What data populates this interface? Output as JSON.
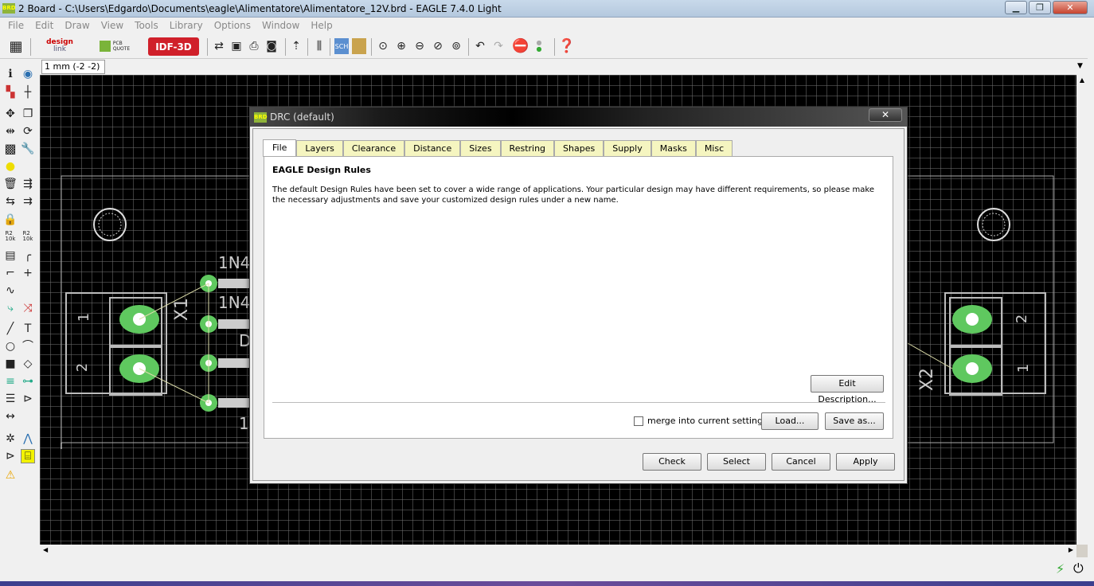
{
  "window": {
    "title": "2 Board - C:\\Users\\Edgardo\\Documents\\eagle\\Alimentatore\\Alimentatore_12V.brd - EAGLE 7.4.0 Light",
    "app_badge": "BRD"
  },
  "menu": [
    "File",
    "Edit",
    "Draw",
    "View",
    "Tools",
    "Library",
    "Options",
    "Window",
    "Help"
  ],
  "toolbar": {
    "designlink": "design",
    "designlink2": "link",
    "pcbquote": "PCB",
    "pcbquote2": "QUOTE",
    "idf": "IDF-3D"
  },
  "coord": "1 mm (-2 -2)",
  "board": {
    "x1": "X1",
    "x2": "X2",
    "p1": "1",
    "p2": "2",
    "q1": "2",
    "q2": "1",
    "d1": "1N4",
    "d2": "1N4",
    "d3": "D",
    "d4": "1"
  },
  "dialog": {
    "title": "DRC (default)",
    "tabs": [
      "File",
      "Layers",
      "Clearance",
      "Distance",
      "Sizes",
      "Restring",
      "Shapes",
      "Supply",
      "Masks",
      "Misc"
    ],
    "heading": "EAGLE Design Rules",
    "description": "The default Design Rules have been set to cover a wide range of applications. Your particular design may have different requirements, so please make the necessary adjustments and save your customized design rules under a new name.",
    "edit_description": "Edit Description...",
    "merge_label": "merge into current settings",
    "load": "Load...",
    "save_as": "Save as...",
    "check": "Check",
    "select": "Select",
    "cancel": "Cancel",
    "apply": "Apply"
  },
  "highlight_color": "#f2f200"
}
